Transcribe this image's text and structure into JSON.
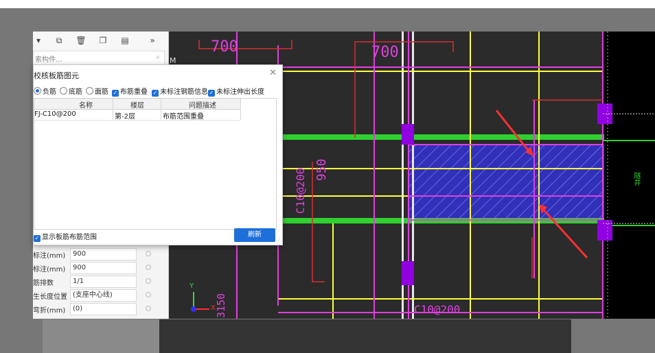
{
  "left_panel": {
    "search_placeholder": "索构件...",
    "properties": [
      {
        "label": "标注(mm)",
        "value": "900"
      },
      {
        "label": "标注(mm)",
        "value": "900"
      },
      {
        "label": "筋排数",
        "value": "1/1"
      },
      {
        "label": "生长度位置",
        "value": "(支座中心线)"
      },
      {
        "label": "弯折(mm)",
        "value": "(0)"
      }
    ]
  },
  "dialog": {
    "title": "校核板筋图元",
    "close_glyph": "✕",
    "options": {
      "radio_negative": "负筋",
      "radio_bottom": "底筋",
      "radio_top": "面筋",
      "check_overlap": "布筋重叠",
      "check_unmarked_info": "未标注钢筋信息",
      "check_unmarked_length": "未标注伸出长度"
    },
    "table": {
      "headers": [
        "名称",
        "楼层",
        "问题描述"
      ],
      "rows": [
        {
          "name": "FJ-C10@200",
          "floor": "第-2层",
          "issue": "布筋范围重叠"
        }
      ]
    },
    "show_range_label": "显示板筋布筋范围",
    "refresh_label": "刷新"
  },
  "cad": {
    "dims": [
      "700",
      "700",
      "950",
      "C10@200",
      "3150",
      "C10@200"
    ],
    "label_well": "隧井",
    "axis_y": "Y",
    "axis_x": "X",
    "m_label": "M"
  },
  "colors": {
    "accent": "#1e6fd9",
    "magenta": "#e040e0",
    "yellow": "#ffff40",
    "green": "#30d030",
    "red": "#d83030",
    "hatch": "#3a3ad0"
  }
}
